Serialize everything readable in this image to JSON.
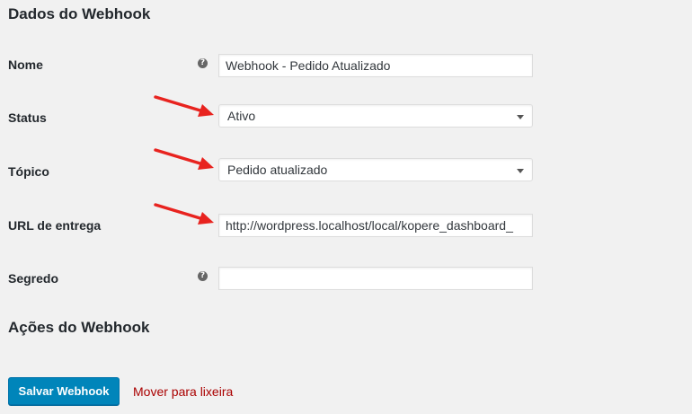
{
  "colors": {
    "background": "#f1f1f1",
    "primary_button": "#0085ba",
    "trash_link": "#aa0000",
    "arrow": "#e8231f"
  },
  "sections": {
    "data_title": "Dados do Webhook",
    "actions_title": "Ações do Webhook"
  },
  "fields": {
    "name": {
      "label": "Nome",
      "help_icon": "?",
      "value": "Webhook - Pedido Atualizado"
    },
    "status": {
      "label": "Status",
      "selected": "Ativo",
      "icon": "chevron-down-icon"
    },
    "topic": {
      "label": "Tópico",
      "selected": "Pedido atualizado",
      "icon": "chevron-down-icon"
    },
    "delivery_url": {
      "label": "URL de entrega",
      "value": "http://wordpress.localhost/local/kopere_dashboard_"
    },
    "secret": {
      "label": "Segredo",
      "help_icon": "?",
      "value": ""
    }
  },
  "actions": {
    "save_label": "Salvar Webhook",
    "trash_label": "Mover para lixeira"
  },
  "annotations": {
    "arrow_icon": "red-arrow-icon"
  }
}
